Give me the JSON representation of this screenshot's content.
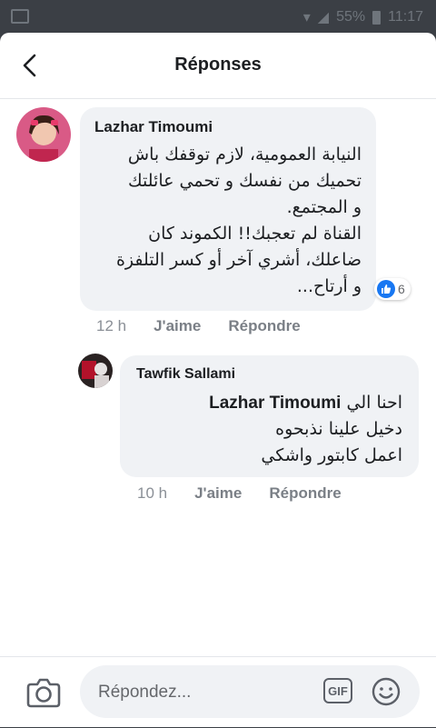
{
  "status_bar": {
    "battery": "55%",
    "time": "11:17"
  },
  "header": {
    "title": "Réponses"
  },
  "comments": [
    {
      "author": "Lazhar Timoumi",
      "lines": [
        "النيابة العمومية، لازم توقفك باش",
        "تحميك من نفسك و تحمي عائلتك",
        "و المجتمع.",
        "القناة لم تعجبك!! الكموند كان",
        "ضاعلك، أشري آخر أو كسر التلفزة",
        "و أرتاح..."
      ],
      "reactions_count": "6",
      "time": "12 h",
      "like_label": "J'aime",
      "reply_label": "Répondre"
    },
    {
      "author": "Tawfik Sallami",
      "mention": "Lazhar Timoumi",
      "first_line_prefix": "احنا الي",
      "lines": [
        "دخيل علينا نذبحوه",
        "اعمل كابتور واشكي"
      ],
      "time": "10 h",
      "like_label": "J'aime",
      "reply_label": "Répondre"
    }
  ],
  "composer": {
    "placeholder": "Répondez...",
    "gif_label": "GIF"
  },
  "colors": {
    "accent": "#1877f2",
    "bubble": "#f0f2f5",
    "status_bar": "#3b3f45"
  }
}
